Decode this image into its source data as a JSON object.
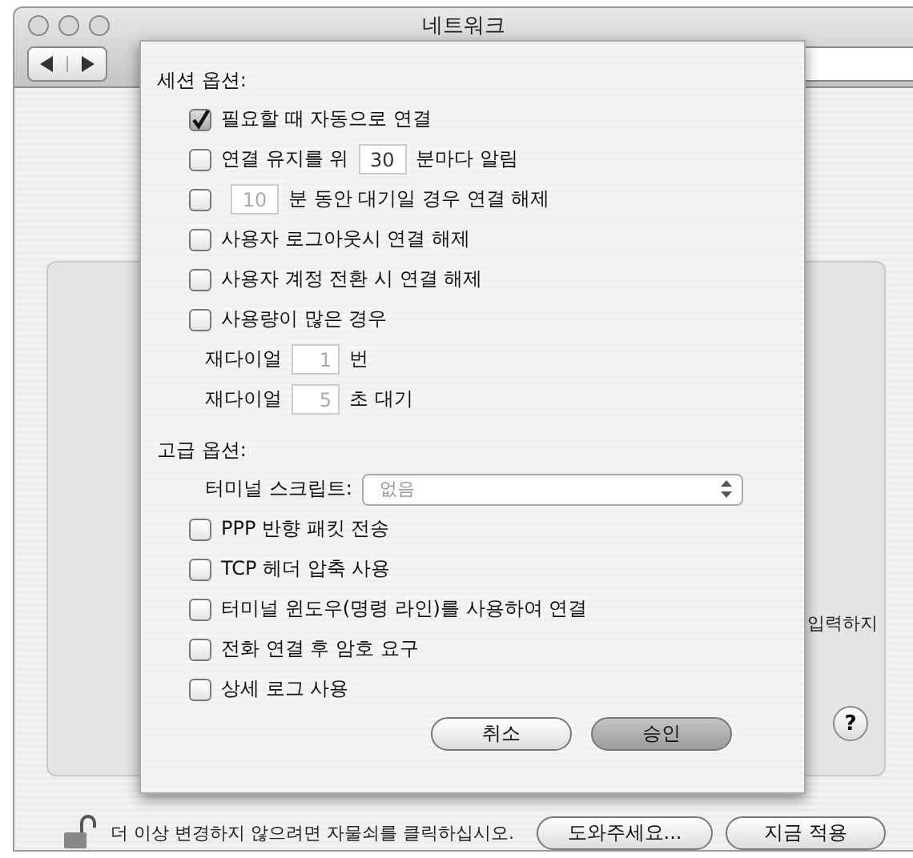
{
  "window": {
    "title": "네트워크"
  },
  "panel": {
    "side_text": "입력하지",
    "help": "?"
  },
  "sheet": {
    "sections": [
      {
        "title": "세션 옵션:",
        "items": [
          {
            "kind": "checkbox",
            "label": "필요할 때 자동으로 연결",
            "checked": true
          },
          {
            "kind": "checkbox_field",
            "before": "연결 유지를 위",
            "value": "30",
            "after": "분마다 알림",
            "checked": false,
            "disabled": false
          },
          {
            "kind": "checkbox_field",
            "value": "10",
            "after": "분 동안 대기일 경우 연결 해제",
            "checked": false,
            "disabled": true
          },
          {
            "kind": "checkbox",
            "label": "사용자 로그아웃시 연결 해제",
            "checked": false
          },
          {
            "kind": "checkbox",
            "label": "사용자 계정 전환 시 연결 해제",
            "checked": false
          },
          {
            "kind": "checkbox",
            "label": "사용량이 많은 경우",
            "checked": false
          },
          {
            "kind": "field",
            "before": "재다이얼",
            "value": "1",
            "after": "번"
          },
          {
            "kind": "field",
            "before": "재다이얼",
            "value": "5",
            "after": "초 대기"
          }
        ]
      },
      {
        "title": "고급 옵션:",
        "items": [
          {
            "kind": "select",
            "before": "터미널 스크립트:",
            "value": "없음"
          },
          {
            "kind": "checkbox",
            "label": "PPP 반향 패킷 전송",
            "checked": false
          },
          {
            "kind": "checkbox",
            "label": "TCP 헤더 압축 사용",
            "checked": false
          },
          {
            "kind": "checkbox",
            "label": "터미널 윈도우(명령 라인)를 사용하여 연결",
            "checked": false
          },
          {
            "kind": "checkbox",
            "label": "전화 연결 후 암호 요구",
            "checked": false
          },
          {
            "kind": "checkbox",
            "label": "상세 로그 사용",
            "checked": false
          }
        ]
      }
    ],
    "buttons": [
      {
        "label": "취소",
        "default": false
      },
      {
        "label": "승인",
        "default": true
      }
    ]
  },
  "footer": {
    "text": "더 이상 변경하지 않으려면 자물쇠를 클릭하십시오.",
    "buttons": [
      "도와주세요...",
      "지금 적용"
    ]
  }
}
